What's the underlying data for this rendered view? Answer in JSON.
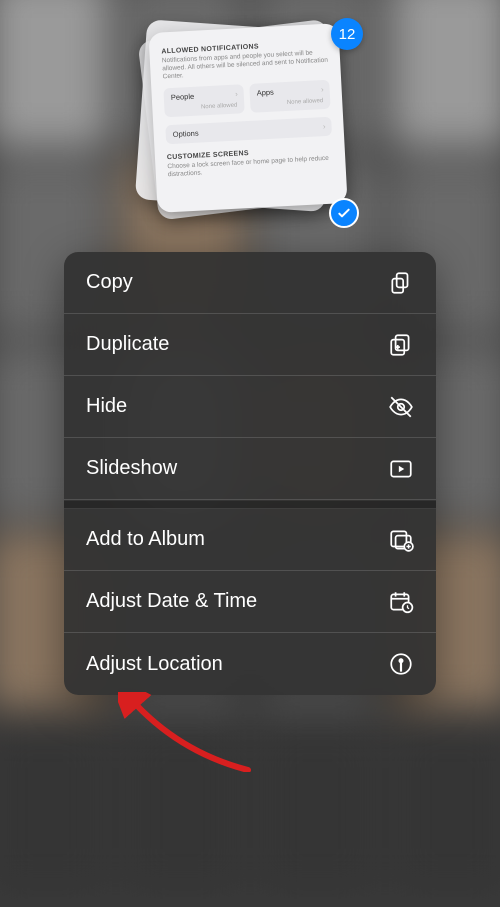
{
  "selection": {
    "count": "12",
    "card": {
      "allowed_title": "ALLOWED NOTIFICATIONS",
      "allowed_desc": "Notifications from apps and people you select will be allowed. All others will be silenced and sent to Notification Center.",
      "people_label": "People",
      "people_sub": "None allowed",
      "apps_label": "Apps",
      "apps_sub": "None allowed",
      "options_label": "Options",
      "customize_title": "CUSTOMIZE SCREENS",
      "customize_desc": "Choose a lock screen face or home page to help reduce distractions."
    }
  },
  "menu": {
    "copy": "Copy",
    "duplicate": "Duplicate",
    "hide": "Hide",
    "slideshow": "Slideshow",
    "add_to_album": "Add to Album",
    "adjust_date_time": "Adjust Date & Time",
    "adjust_location": "Adjust Location"
  },
  "colors": {
    "accent": "#0a84ff"
  }
}
